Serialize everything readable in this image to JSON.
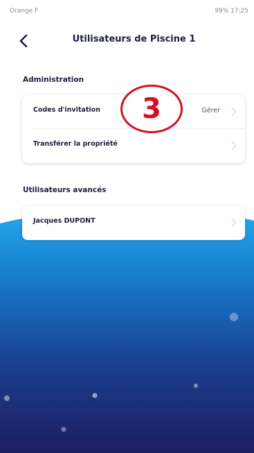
{
  "status_bar": {
    "left": "Orange F",
    "right": "99% 17:25"
  },
  "header": {
    "title": "Utilisateurs de Piscine 1"
  },
  "step_badge": "3",
  "administration": {
    "heading": "Administration",
    "rows": [
      {
        "label": "Codes d'invitation",
        "value": "Gérer"
      },
      {
        "label": "Transférer la propriété",
        "value": ""
      }
    ]
  },
  "advanced_users": {
    "heading": "Utilisateurs avancés",
    "rows": [
      {
        "label": "Jacques DUPONT",
        "value": ""
      }
    ]
  },
  "colors": {
    "title": "#1b1f3b",
    "badge": "#d4101f",
    "water_top": "#1c9ae3",
    "water_bottom": "#1d1f63"
  }
}
